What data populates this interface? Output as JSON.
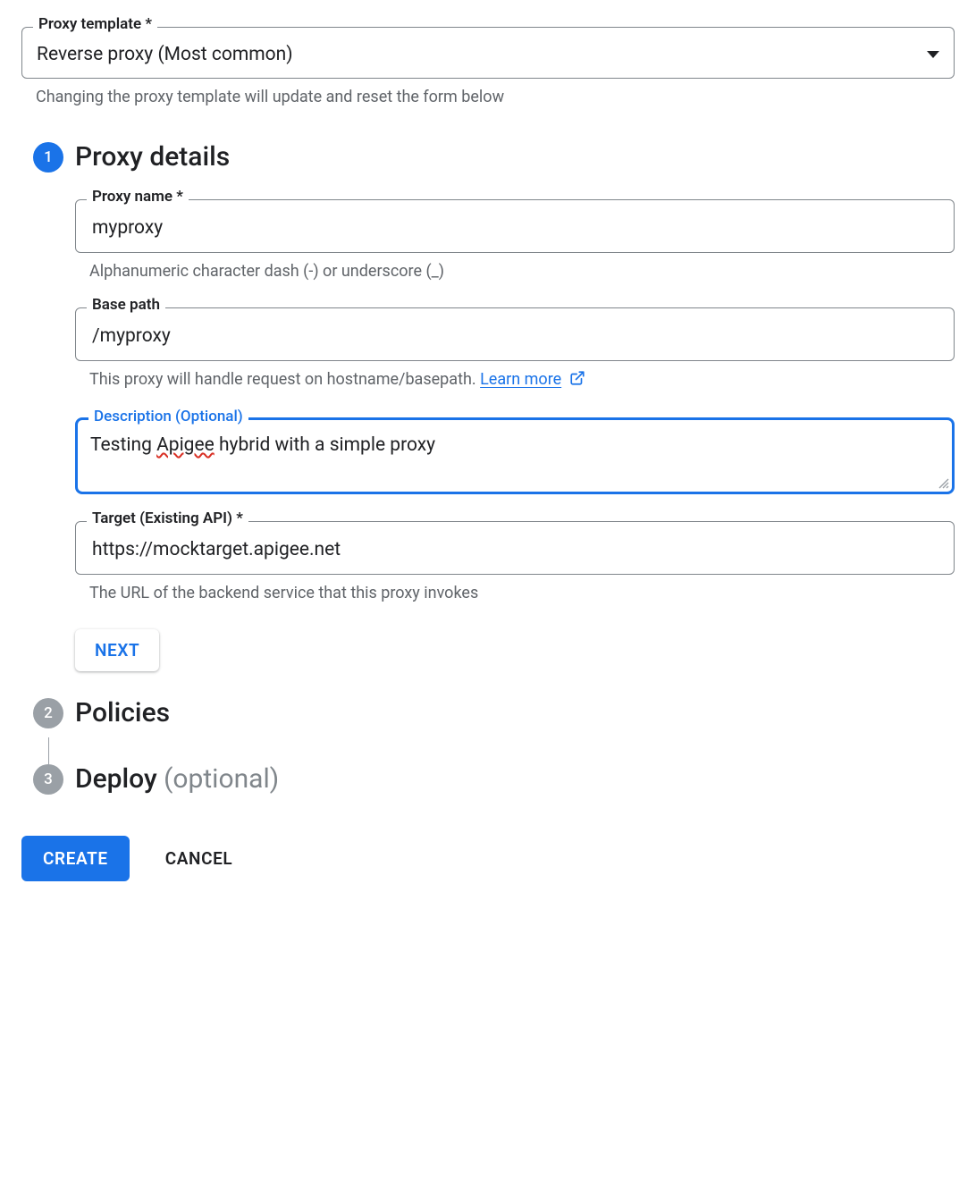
{
  "templateField": {
    "label": "Proxy template *",
    "value": "Reverse proxy (Most common)",
    "helper": "Changing the proxy template will update and reset the form below"
  },
  "steps": {
    "details": {
      "number": "1",
      "title": "Proxy details"
    },
    "policies": {
      "number": "2",
      "title": "Policies"
    },
    "deploy": {
      "number": "3",
      "title": "Deploy",
      "optional": "(optional)"
    }
  },
  "proxyName": {
    "label": "Proxy name *",
    "value": "myproxy",
    "helper": "Alphanumeric character dash (-) or underscore (_)"
  },
  "basePath": {
    "label": "Base path",
    "value": "/myproxy",
    "helperPrefix": "This proxy will handle request on hostname/basepath. ",
    "learnMore": "Learn more"
  },
  "description": {
    "label": "Description (Optional)",
    "textBefore": "Testing ",
    "textMisspelled": "Apigee",
    "textAfter": " hybrid with a simple proxy"
  },
  "target": {
    "label": "Target (Existing API) *",
    "value": "https://mocktarget.apigee.net",
    "helper": "The URL of the backend service that this proxy invokes"
  },
  "buttons": {
    "next": "NEXT",
    "create": "CREATE",
    "cancel": "CANCEL"
  }
}
